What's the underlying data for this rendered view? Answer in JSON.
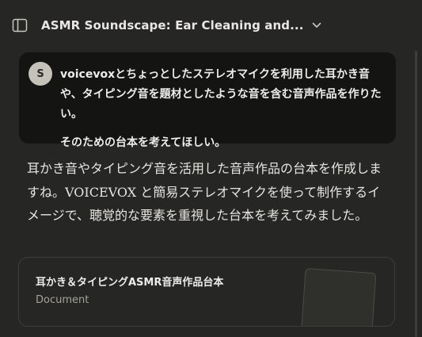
{
  "header": {
    "title": "ASMR Soundscape: Ear Cleaning and...",
    "sidebar_icon": "sidebar-toggle-icon",
    "chevron_icon": "chevron-down-icon"
  },
  "user_message": {
    "avatar_initial": "S",
    "paragraphs": [
      "voicevoxとちょっとしたステレオマイクを利用した耳かき音や、タイピング音を題材としたような音を含む音声作品を作りたい。",
      "そのための台本を考えてほしい。"
    ]
  },
  "assistant_message": {
    "text": "耳かき音やタイピング音を活用した音声作品の台本を作成しますね。VOICEVOX と簡易ステレオマイクを使って制作するイメージで、聴覚的な要素を重視した台本を考えてみました。"
  },
  "artifact": {
    "title": "耳かき＆タイピングASMR音声作品台本",
    "type": "Document"
  },
  "colors": {
    "background": "#262624",
    "user_bubble": "#141413",
    "avatar": "#c5c2b9",
    "muted_text": "#a3a19a"
  }
}
